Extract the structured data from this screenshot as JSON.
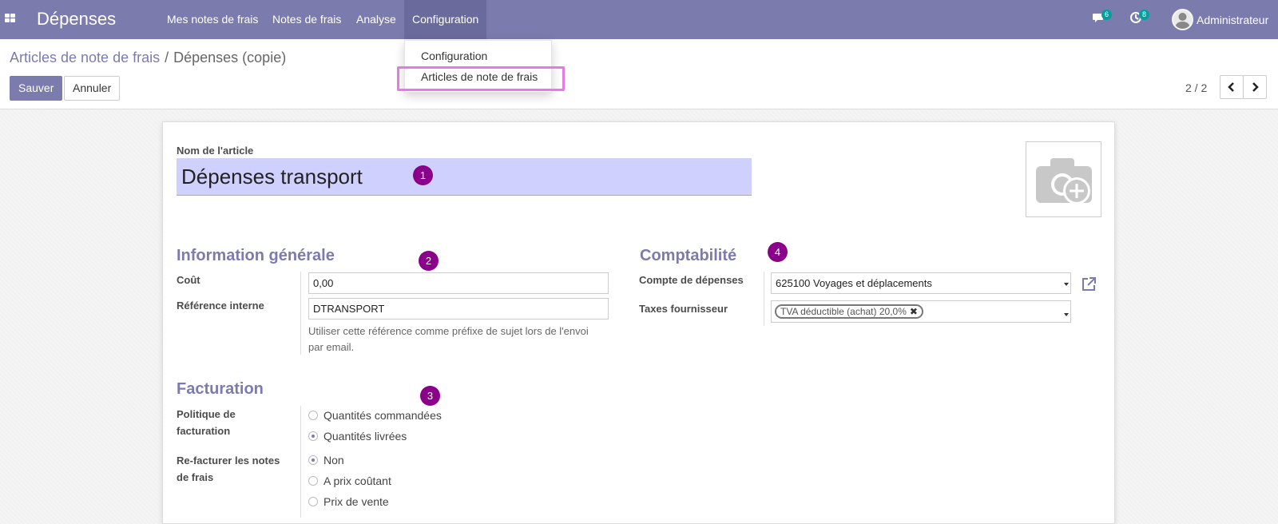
{
  "navbar": {
    "brand": "Dépenses",
    "menu": [
      "Mes notes de frais",
      "Notes de frais",
      "Analyse",
      "Configuration"
    ],
    "messages_count": "6",
    "activities_count": "8",
    "user": "Administrateur"
  },
  "dropdown": {
    "items": [
      "Configuration",
      "Articles de note de frais"
    ]
  },
  "breadcrumb": {
    "parent": "Articles de note de frais",
    "separator": "/",
    "current": "Dépenses (copie)"
  },
  "buttons": {
    "save": "Sauver",
    "discard": "Annuler"
  },
  "pager": {
    "value": "2 / 2"
  },
  "form": {
    "name_label": "Nom de l'article",
    "name_value": "Dépenses transport",
    "markers": [
      "1",
      "2",
      "3",
      "4"
    ],
    "general": {
      "title": "Information générale",
      "cost_label": "Coût",
      "cost_value": "0,00",
      "ref_label": "Référence interne",
      "ref_value": "DTRANSPORT",
      "ref_help_1": "Utiliser cette référence comme préfixe de sujet lors de l'envoi",
      "ref_help_2": "par email."
    },
    "billing": {
      "title": "Facturation",
      "policy_label_1": "Politique de",
      "policy_label_2": "facturation",
      "policy_options": [
        "Quantités commandées",
        "Quantités livrées"
      ],
      "policy_selected": 1,
      "reinvoice_label_1": "Re-facturer les notes",
      "reinvoice_label_2": "de frais",
      "reinvoice_options": [
        "Non",
        "A prix coûtant",
        "Prix de vente"
      ],
      "reinvoice_selected": 0
    },
    "accounting": {
      "title": "Comptabilité",
      "account_label": "Compte de dépenses",
      "account_value": "625100 Voyages et déplacements",
      "taxes_label": "Taxes fournisseur",
      "tax_tag": "TVA déductible (achat) 20,0%"
    }
  },
  "colors": {
    "primary": "#7c7bad",
    "marker": "#8b008b",
    "highlight": "#e37be3",
    "name_field": "#d0d0ff"
  }
}
